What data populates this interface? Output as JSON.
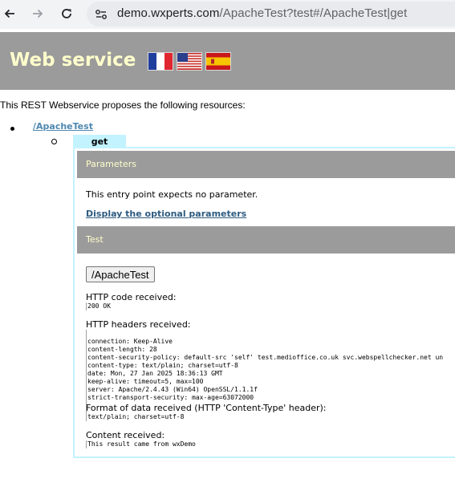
{
  "browser": {
    "url_host": "demo.wxperts.com",
    "url_path": "/ApacheTest?test#/ApacheTest|get"
  },
  "header": {
    "title": "Web service",
    "flags": [
      "french-flag-icon",
      "us-flag-icon",
      "spanish-flag-icon"
    ]
  },
  "intro": "This REST Webservice proposes the following resources:",
  "resource": {
    "link": "/ApacheTest",
    "method": "get"
  },
  "parameters": {
    "heading": "Parameters",
    "no_param_text": "This entry point expects no parameter.",
    "optional_link": "Display the optional parameters"
  },
  "test": {
    "heading": "Test",
    "button_label": "/ApacheTest",
    "http_code_label": "HTTP code received:",
    "http_code_value": "200 OK",
    "headers_label": "HTTP headers received:",
    "headers": [
      "connection: Keep-Alive",
      "content-length: 28",
      "content-security-policy: default-src 'self' test.medioffice.co.uk svc.webspellchecker.net un",
      "content-type: text/plain; charset=utf-8",
      "date: Mon, 27 Jan 2025 18:36:13 GMT",
      "keep-alive: timeout=5, max=100",
      "server: Apache/2.4.43 (Win64) OpenSSL/1.1.1f",
      "strict-transport-security: max-age=63072000"
    ],
    "format_label": "Format of data received (HTTP 'Content-Type' header):",
    "format_value": "text/plain; charset=utf-8",
    "content_label": "Content received:",
    "content_value": "This result came from wxDemo"
  },
  "colors": {
    "header_bg": "#9b9b9b",
    "header_text": "#ffffcc",
    "tab_bg": "#c2f3ff",
    "link": "#4e88b0"
  }
}
